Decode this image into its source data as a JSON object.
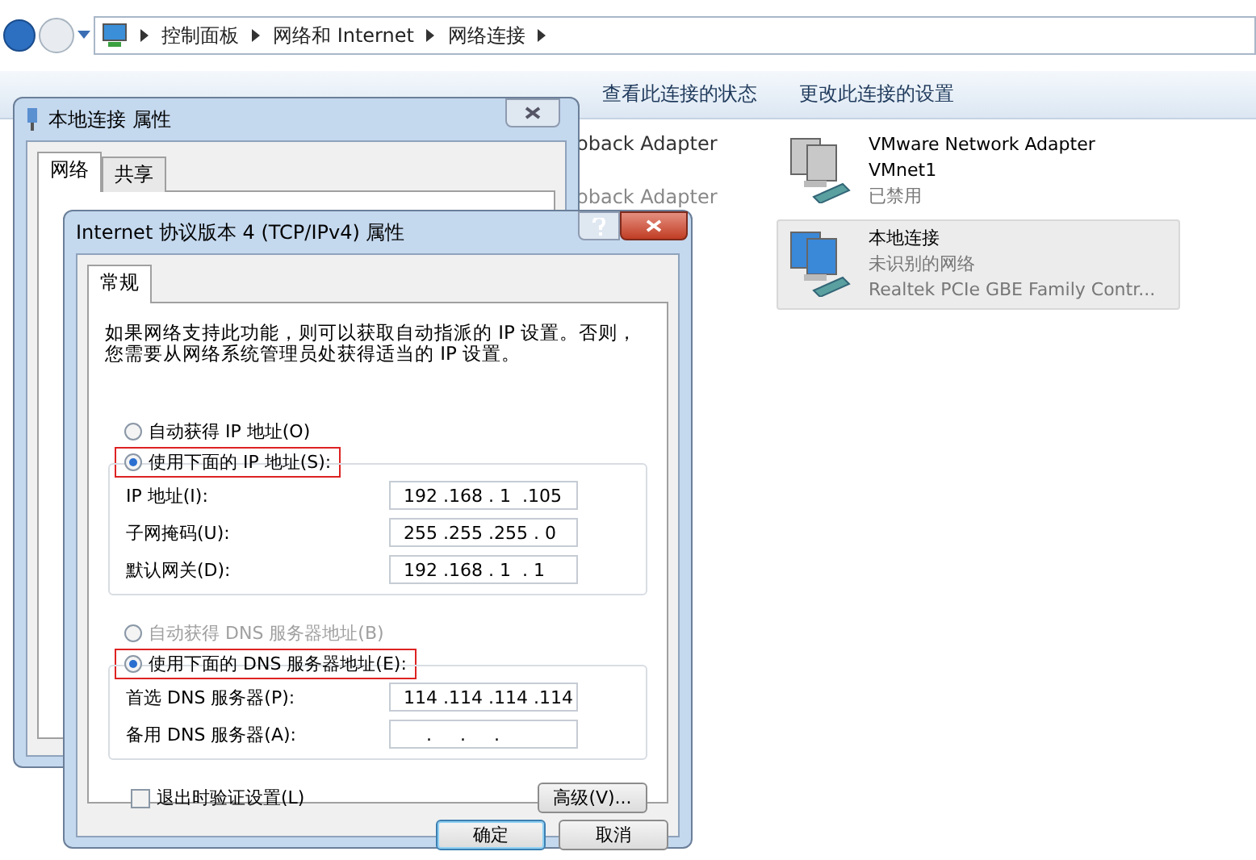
{
  "explorer": {
    "breadcrumb": [
      "控制面板",
      "网络和 Internet",
      "网络连接"
    ],
    "toolbar": [
      {
        "label": "查看此连接的状态"
      },
      {
        "label": "更改此连接的设置"
      }
    ],
    "hidden_adapters": [
      {
        "name": "oback Adapter",
        "disabled": false
      },
      {
        "name": "oback Adapter",
        "disabled": true
      }
    ],
    "adapters": [
      {
        "name": "VMware Network Adapter VMnet1",
        "status": "已禁用",
        "disabled": true,
        "selected": false
      },
      {
        "name": "本地连接",
        "status": "未识别的网络",
        "device": "Realtek PCIe GBE Family Contr...",
        "disabled": false,
        "selected": true
      }
    ]
  },
  "back_dialog": {
    "title": "本地连接 属性",
    "tabs": [
      {
        "label": "网络",
        "selected": true
      },
      {
        "label": "共享",
        "selected": false
      }
    ]
  },
  "dialog": {
    "title": "Internet 协议版本 4 (TCP/IPv4) 属性",
    "tabs": [
      {
        "label": "常规",
        "selected": true
      }
    ],
    "description": "如果网络支持此功能，则可以获取自动指派的 IP 设置。否则，您需要从网络系统管理员处获得适当的 IP 设置。",
    "ip_options": [
      {
        "label": "自动获得 IP 地址(O)",
        "selected": false,
        "disabled": false,
        "highlighted": false
      },
      {
        "label": "使用下面的 IP 地址(S):",
        "selected": true,
        "disabled": false,
        "highlighted": true
      }
    ],
    "ip_fields": [
      {
        "label": "IP 地址(I):",
        "value": "192 .168 . 1  .105"
      },
      {
        "label": "子网掩码(U):",
        "value": "255 .255 .255 . 0"
      },
      {
        "label": "默认网关(D):",
        "value": "192 .168 . 1  . 1"
      }
    ],
    "dns_options": [
      {
        "label": "自动获得 DNS 服务器地址(B)",
        "selected": false,
        "disabled": true,
        "highlighted": false
      },
      {
        "label": "使用下面的 DNS 服务器地址(E):",
        "selected": true,
        "disabled": false,
        "highlighted": true
      }
    ],
    "dns_fields": [
      {
        "label": "首选 DNS 服务器(P):",
        "value": "114 .114 .114 .114"
      },
      {
        "label": "备用 DNS 服务器(A):",
        "value": "    .     .     ."
      }
    ],
    "validate": {
      "label": "退出时验证设置(L)",
      "checked": false
    },
    "advanced_button": "高级(V)...",
    "buttons": [
      {
        "label": "确定",
        "default": true
      },
      {
        "label": "取消",
        "default": false
      }
    ]
  }
}
